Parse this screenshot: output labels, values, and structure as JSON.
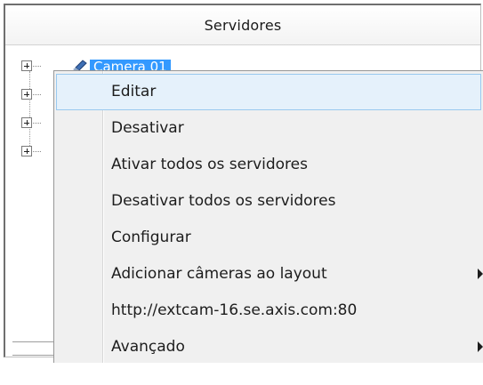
{
  "panel": {
    "header_title": "Servidores"
  },
  "tree": {
    "selected_node_label": "Camera 01",
    "selected_icon": "camera-icon",
    "expander_icon": "plus-box-icon",
    "expandable_rows": 4
  },
  "context_menu": {
    "items": [
      {
        "label": "Editar",
        "highlighted": true,
        "submenu": false
      },
      {
        "label": "Desativar",
        "highlighted": false,
        "submenu": false
      },
      {
        "label": "Ativar todos os servidores",
        "highlighted": false,
        "submenu": false
      },
      {
        "label": "Desativar todos os servidores",
        "highlighted": false,
        "submenu": false
      },
      {
        "label": "Configurar",
        "highlighted": false,
        "submenu": false
      },
      {
        "label": "Adicionar câmeras ao layout",
        "highlighted": false,
        "submenu": true
      },
      {
        "label": "http://extcam-16.se.axis.com:80",
        "highlighted": false,
        "submenu": false
      },
      {
        "label": "Avançado",
        "highlighted": false,
        "submenu": true
      }
    ]
  },
  "colors": {
    "selection_bg": "#3399ff",
    "menu_bg": "#f0f0f0",
    "menu_highlight_bg": "#e5f1fb",
    "menu_highlight_border": "#99c9ef"
  }
}
